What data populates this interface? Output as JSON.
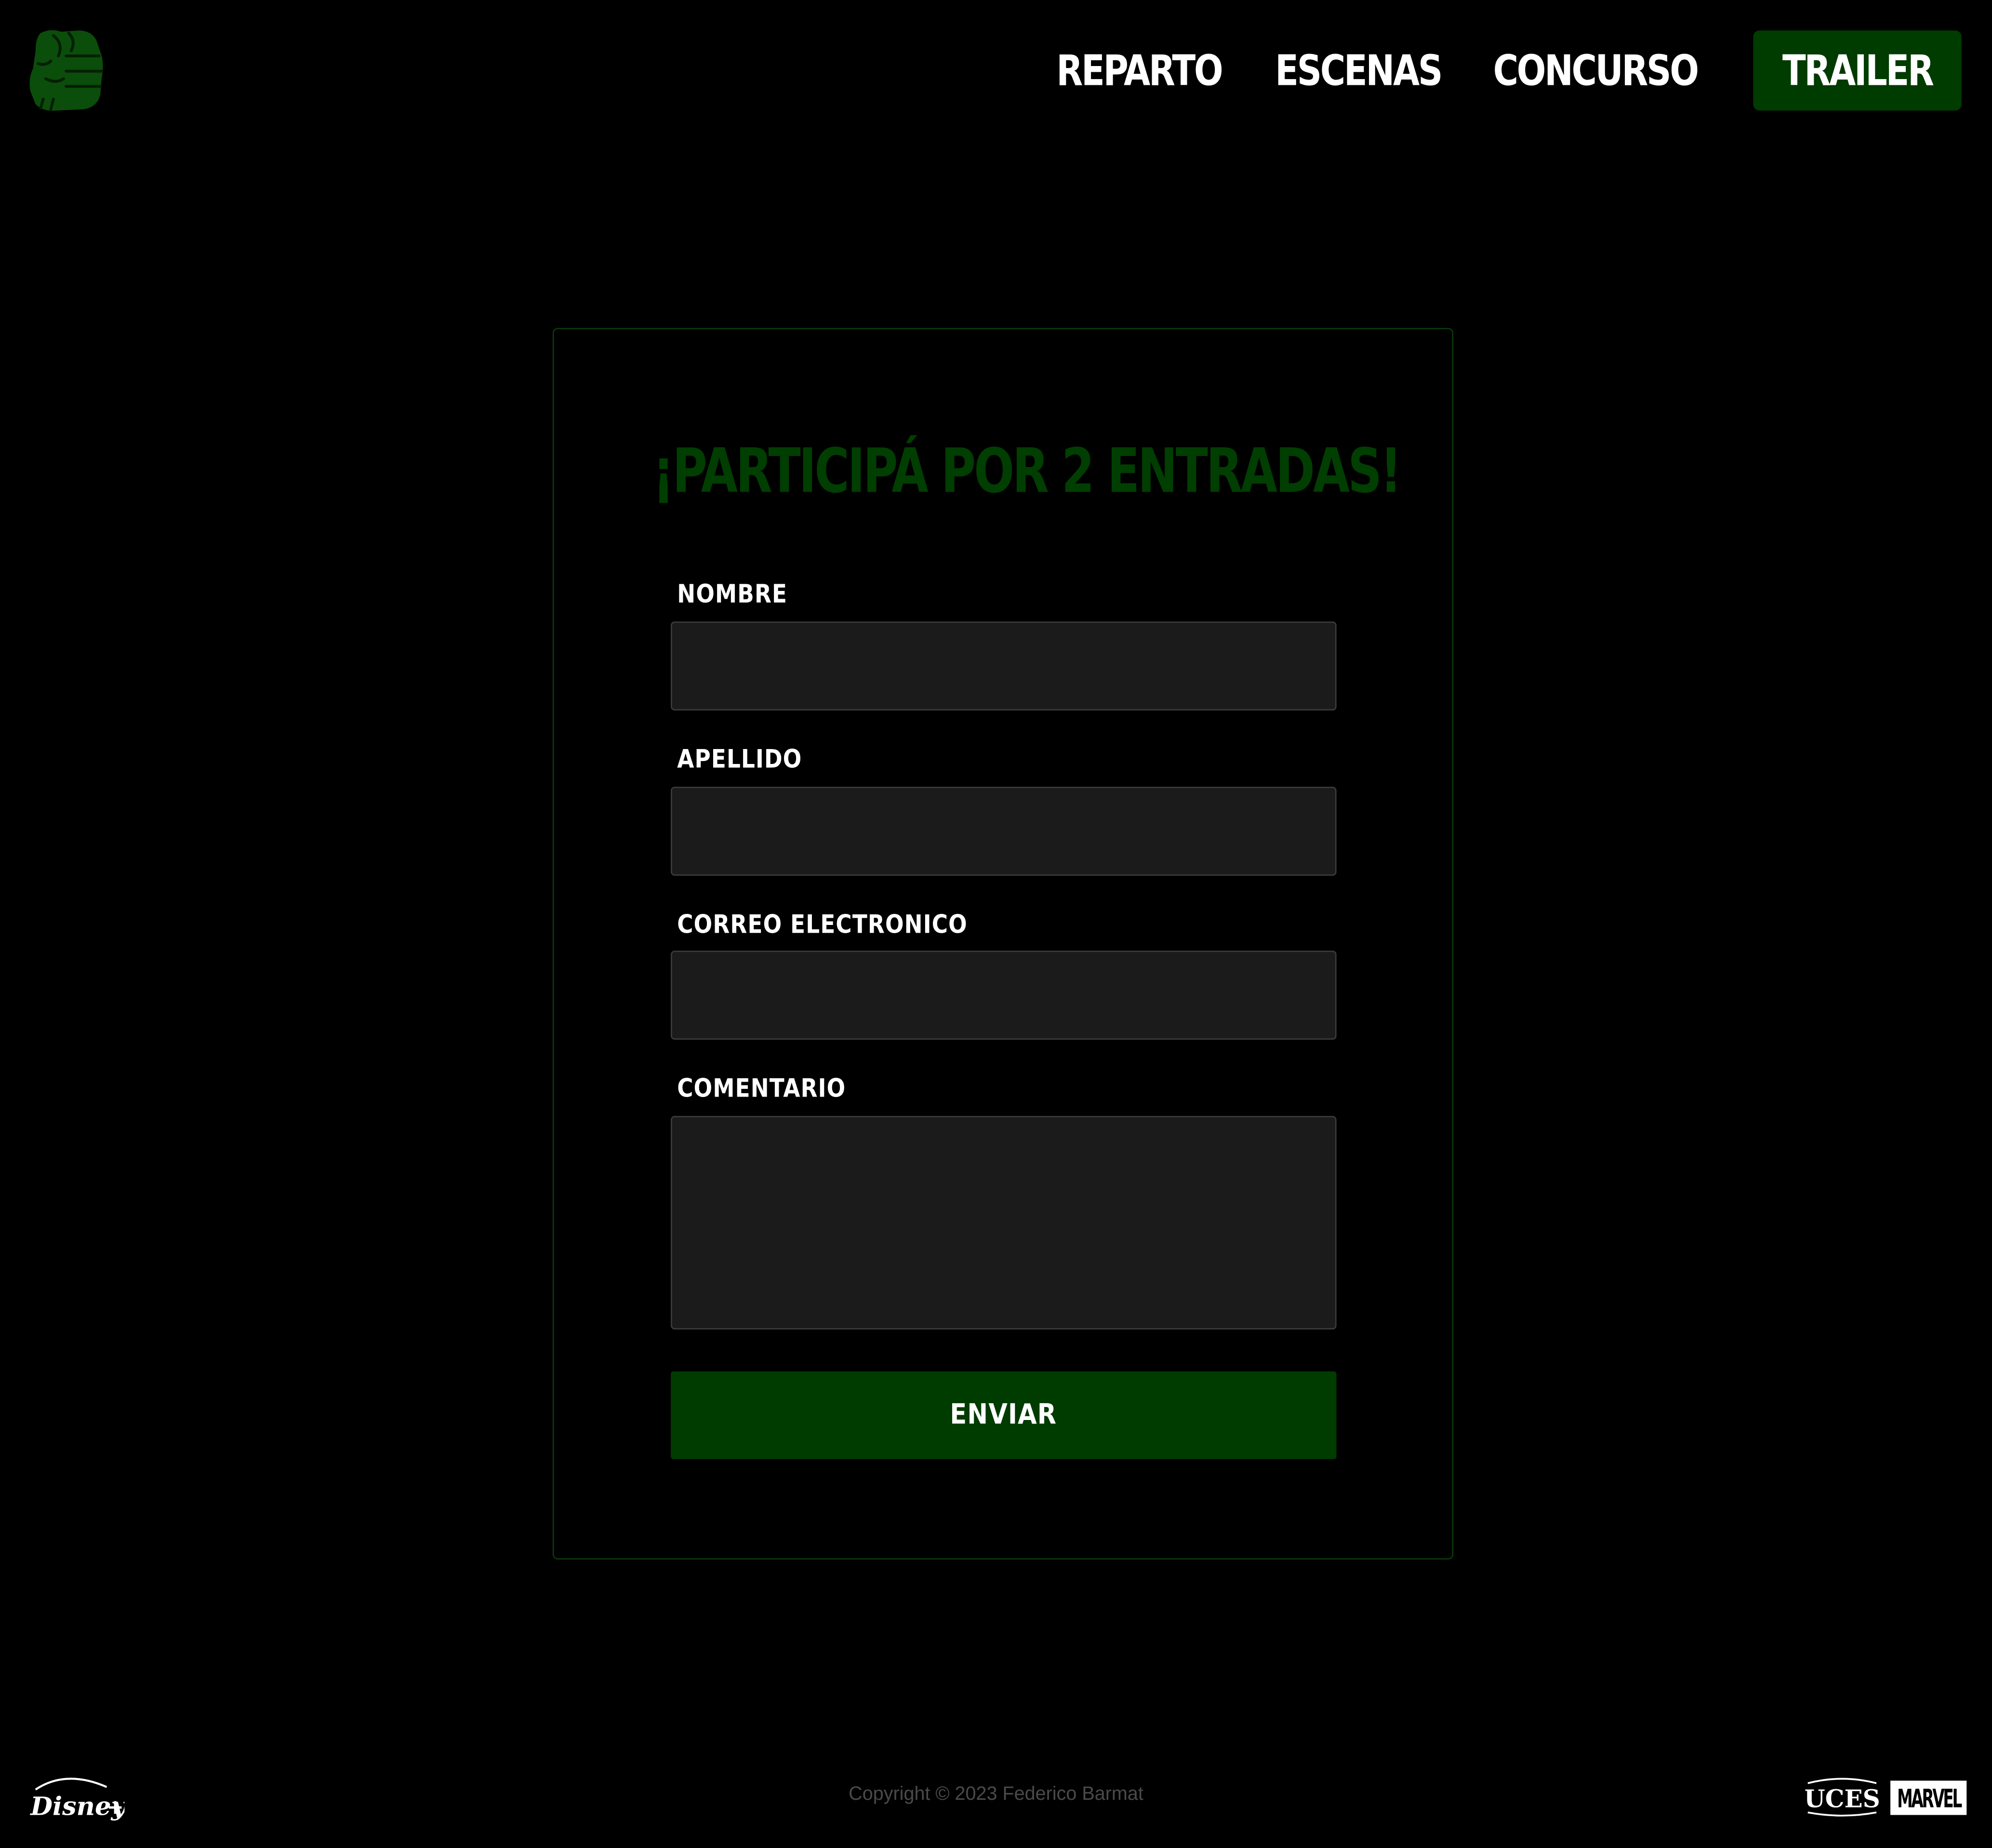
{
  "brand": {
    "logo_icon": "green-fist-icon",
    "accent_color": "#003b00",
    "title_color": "#013e01"
  },
  "nav": {
    "items": [
      {
        "label": "REPARTO"
      },
      {
        "label": "ESCENAS"
      },
      {
        "label": "CONCURSO"
      }
    ],
    "trailer_label": "TRAILER"
  },
  "form": {
    "title": "¡PARTICIPÁ POR 2 ENTRADAS!",
    "fields": [
      {
        "label": "NOMBRE",
        "value": "",
        "placeholder": ""
      },
      {
        "label": "APELLIDO",
        "value": "",
        "placeholder": ""
      },
      {
        "label": "CORREO ELECTRONICO",
        "value": "",
        "placeholder": ""
      },
      {
        "label": "COMENTARIO",
        "value": "",
        "placeholder": ""
      }
    ],
    "submit_label": "ENVIAR"
  },
  "footer": {
    "copyright": "Copyright © 2023 Federico Barmat",
    "logos": {
      "disney": "Disney+",
      "uces": "UCES",
      "marvel": "MARVEL"
    }
  }
}
